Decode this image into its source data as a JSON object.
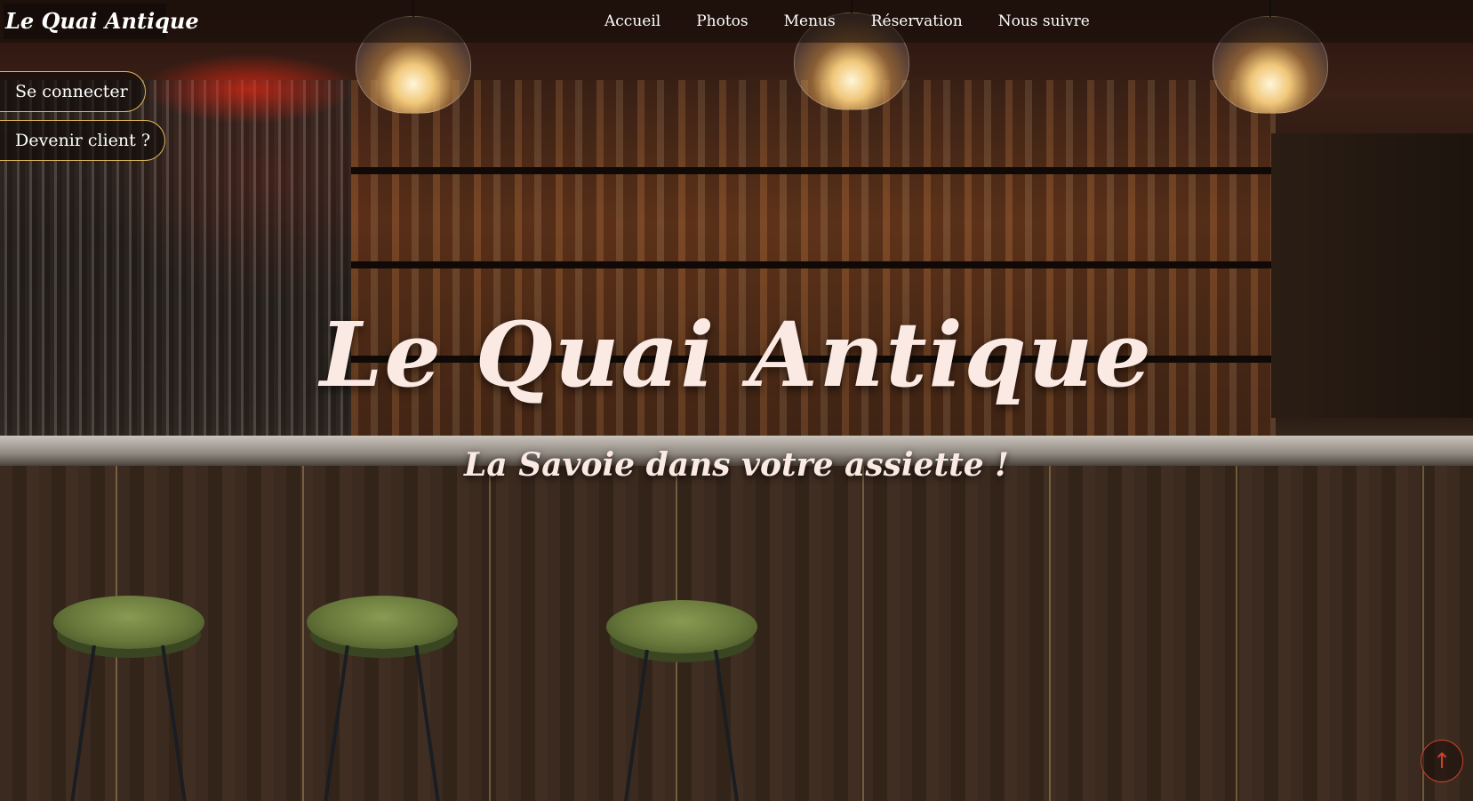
{
  "logo": {
    "text": "Le Quai Antique"
  },
  "nav": {
    "items": [
      {
        "label": "Accueil"
      },
      {
        "label": "Photos"
      },
      {
        "label": "Menus"
      },
      {
        "label": "Réservation"
      },
      {
        "label": "Nous suivre"
      }
    ]
  },
  "auth": {
    "login_label": "Se connecter",
    "signup_label": "Devenir client ?"
  },
  "hero": {
    "title": "Le Quai Antique",
    "subtitle": "La Savoie dans votre assiette !"
  },
  "scroll_top": {
    "icon": "arrow-up-icon",
    "glyph": "↑",
    "color": "#d2402c"
  },
  "colors": {
    "accent": "#d9b25a",
    "title": "#fbe9e4"
  }
}
